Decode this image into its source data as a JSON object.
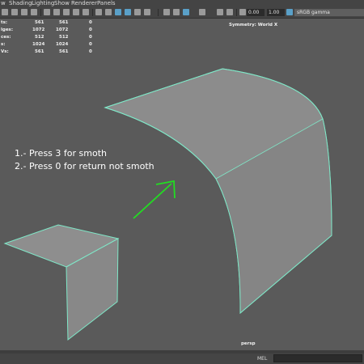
{
  "menu": [
    "w",
    "Shading",
    "Lighting",
    "Show",
    "Renderer",
    "Panels"
  ],
  "toolbar": {
    "field1": "0.00",
    "field2": "1.00",
    "color_space": "sRGB gamma",
    "icons": [
      "view-icon",
      "camera-icon",
      "grid-icon",
      "wireframe-icon",
      "shaded-icon",
      "textured-icon",
      "lights-icon",
      "shadows-icon",
      "isolate-icon",
      "xray-icon",
      "exposure-icon",
      "gamma-icon"
    ]
  },
  "hud": {
    "rows": [
      {
        "label": "ts:",
        "a": "561",
        "b": "561",
        "c": "0"
      },
      {
        "label": "lges:",
        "a": "1072",
        "b": "1072",
        "c": "0"
      },
      {
        "label": "ces:",
        "a": "512",
        "b": "512",
        "c": "0"
      },
      {
        "label": "s:",
        "a": "1024",
        "b": "1024",
        "c": "0"
      },
      {
        "label": "Vs:",
        "a": "561",
        "b": "561",
        "c": "0"
      }
    ],
    "symmetry": "Symmetry: World X"
  },
  "annotation": {
    "line1": "1.- Press 3 for smoth",
    "line2": "2.- Press 0 for return not smoth",
    "arrow_color": "#22dd22"
  },
  "camera": "persp",
  "command": {
    "label": "MEL"
  },
  "colors": {
    "mesh_face": "#8c8c8c",
    "mesh_edge": "#7fe8c8",
    "background": "#5a5a5a"
  }
}
